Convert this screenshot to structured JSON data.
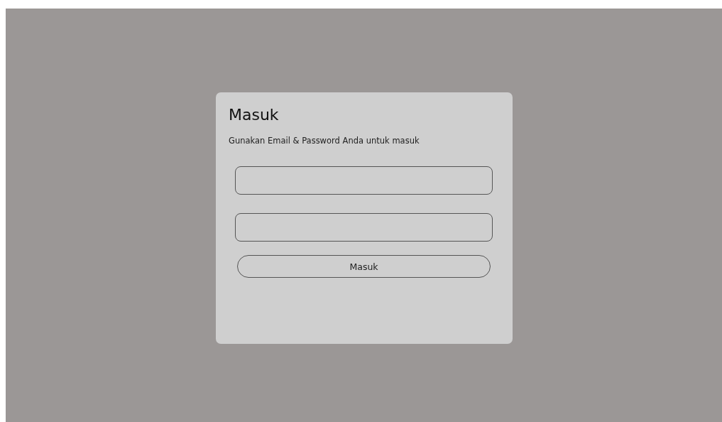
{
  "card": {
    "title": "Masuk",
    "subtitle": "Gunakan Email & Password Anda untuk masuk"
  },
  "fields": [
    {
      "kind": "text"
    },
    {
      "kind": "text"
    }
  ],
  "button": {
    "label": "Masuk"
  }
}
